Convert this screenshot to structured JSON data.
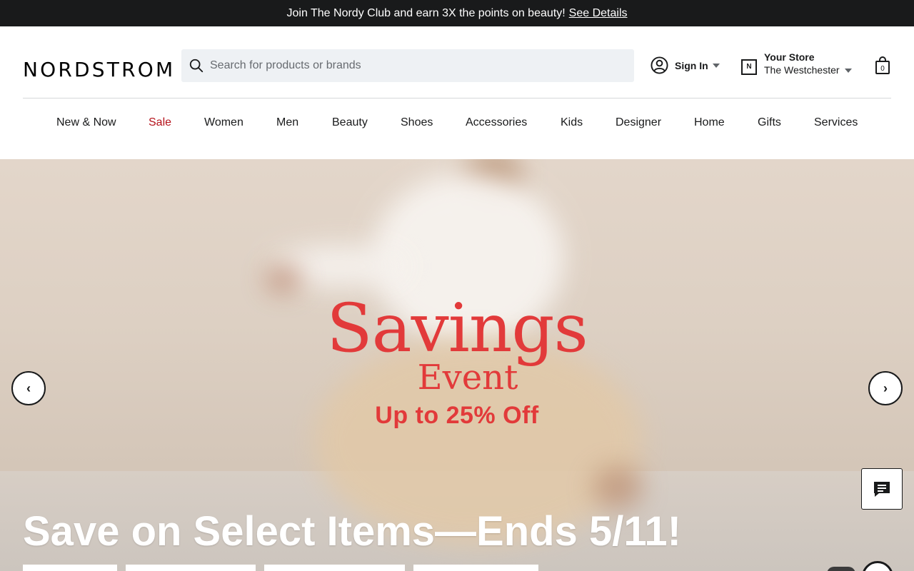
{
  "promo": {
    "text": "Join The Nordy Club and earn 3X the points on beauty!",
    "link": "See Details"
  },
  "header": {
    "logo": "NORDSTROM",
    "search_placeholder": "Search for products or brands",
    "sign_in": "Sign In",
    "store_label": "Your Store",
    "store_name": "The Westchester",
    "bag_count": "0"
  },
  "nav": {
    "items": [
      {
        "label": "New & Now"
      },
      {
        "label": "Sale"
      },
      {
        "label": "Women"
      },
      {
        "label": "Men"
      },
      {
        "label": "Beauty"
      },
      {
        "label": "Shoes"
      },
      {
        "label": "Accessories"
      },
      {
        "label": "Kids"
      },
      {
        "label": "Designer"
      },
      {
        "label": "Home"
      },
      {
        "label": "Gifts"
      },
      {
        "label": "Services"
      }
    ]
  },
  "hero": {
    "graphic_line1": "Savings",
    "graphic_line2": "Event",
    "graphic_line3": "Up to 25% Off",
    "headline": "Save on Select Items—Ends 5/11!",
    "prev_icon": "‹",
    "next_icon": "›"
  },
  "colors": {
    "brand_dark": "#191a1b",
    "sale_red": "#b5121b",
    "hero_red": "#e23a3a"
  }
}
